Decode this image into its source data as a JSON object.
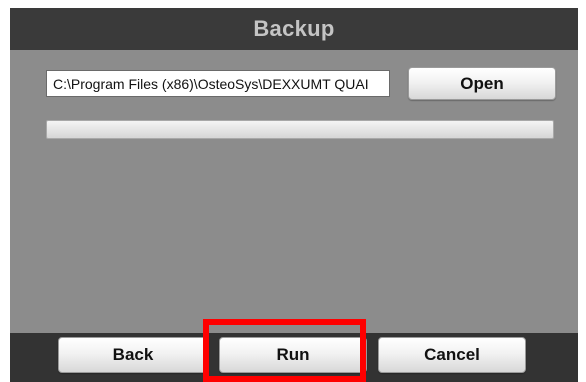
{
  "window": {
    "title": "Backup"
  },
  "path_field": {
    "value": "C:\\Program Files (x86)\\OsteoSys\\DEXXUMT QUAI"
  },
  "buttons": {
    "open_label": "Open",
    "back_label": "Back",
    "run_label": "Run",
    "cancel_label": "Cancel"
  },
  "progress": {
    "value": 0
  },
  "colors": {
    "title_bar": "#3a3a3a",
    "content_bg": "#8c8c8c",
    "footer_bg": "#333333",
    "highlight": "#ff0000"
  }
}
